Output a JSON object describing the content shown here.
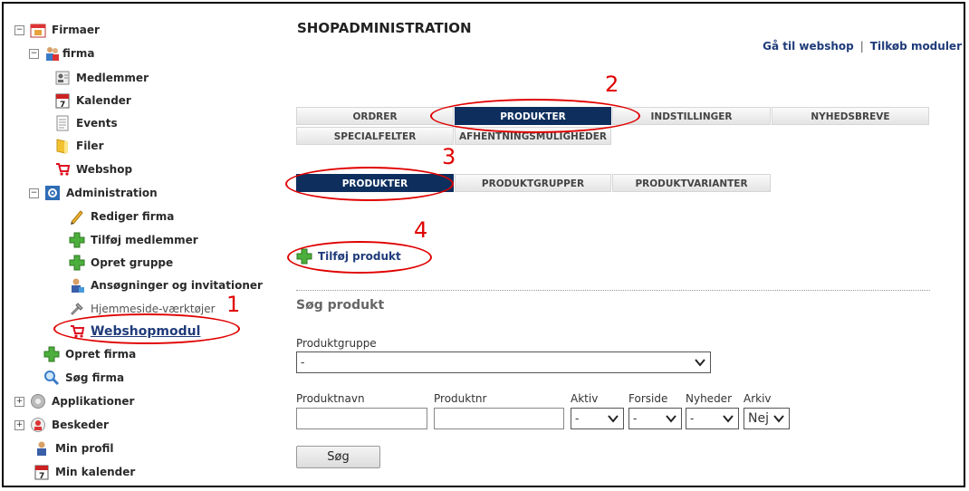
{
  "tree": {
    "firmaer": "Firmaer",
    "firma": "firma",
    "medlemmer": "Medlemmer",
    "kalender": "Kalender",
    "events": "Events",
    "filer": "Filer",
    "webshop": "Webshop",
    "administration": "Administration",
    "rediger": "Rediger firma",
    "tilfoej_medlemmer": "Tilføj medlemmer",
    "opret_gruppe": "Opret gruppe",
    "ansoegninger": "Ansøgninger og invitationer",
    "hjemmeside": "Hjemmeside-værktøjer",
    "webshopmodul": "Webshopmodul",
    "opret_firma": "Opret firma",
    "soeg_firma": "Søg firma",
    "applikationer": "Applikationer",
    "beskeder": "Beskeder",
    "min_profil": "Min profil",
    "min_kalender": "Min kalender",
    "expanded": "−",
    "collapsed": "+"
  },
  "header": {
    "title": "SHOPADMINISTRATION",
    "link_webshop": "Gå til webshop",
    "separator": "|",
    "link_moduler": "Tilkøb moduler"
  },
  "tabs_main": [
    "ORDRER",
    "PRODUKTER",
    "INDSTILLINGER",
    "NYHEDSBREVE",
    "SPECIALFELTER",
    "AFHENTNINGSMULIGHEDER"
  ],
  "tabs_sub": [
    "PRODUKTER",
    "PRODUKTGRUPPER",
    "PRODUKTVARIANTER"
  ],
  "add_product": "Tilføj produkt",
  "search": {
    "title": "Søg produkt",
    "produktgruppe_label": "Produktgruppe",
    "produktgruppe_value": "-",
    "produktnavn_label": "Produktnavn",
    "produktnr_label": "Produktnr",
    "aktiv_label": "Aktiv",
    "aktiv_value": "-",
    "forside_label": "Forside",
    "forside_value": "-",
    "nyheder_label": "Nyheder",
    "nyheder_value": "-",
    "arkiv_label": "Arkiv",
    "arkiv_value": "Nej",
    "button": "Søg"
  },
  "annotations": [
    "1",
    "2",
    "3",
    "4"
  ],
  "colors": {
    "active_tab": "#0e2f5e",
    "link": "#1f3b7a",
    "annotation": "#e00000"
  }
}
